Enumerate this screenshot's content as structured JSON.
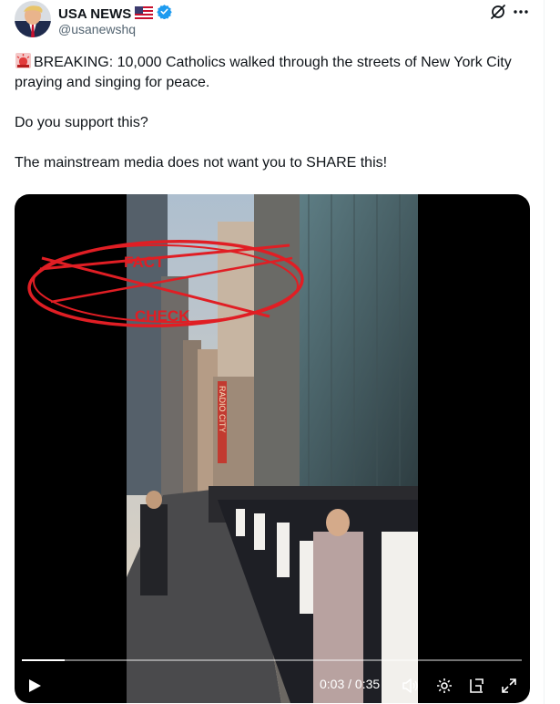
{
  "author": {
    "display_name": "USA NEWS",
    "flag_icon": "us-flag-emoji",
    "handle": "@usanewshq",
    "verified_color": "#1d9bf0"
  },
  "tweet": {
    "emoji_icon": "rotating-light-emoji",
    "line1": "BREAKING: 10,000 Catholics walked through the streets of New York City praying and singing for peace.",
    "line2": "Do you support this?",
    "line3": "The mainstream media does not want you to SHARE this!"
  },
  "media": {
    "overlay_top": "FACT",
    "overlay_bottom": "CHECK",
    "street_sign": "RADIO CITY",
    "progress_fraction": 0.0857,
    "time_current": "0:03",
    "time_separator": "/",
    "time_total": "0:35",
    "overlay_color": "#e01e24"
  },
  "controls": {
    "play_icon": "play-icon",
    "volume_icon": "volume-icon",
    "settings_icon": "gear-icon",
    "pip_icon": "picture-in-picture-icon",
    "fullscreen_icon": "fullscreen-icon"
  }
}
